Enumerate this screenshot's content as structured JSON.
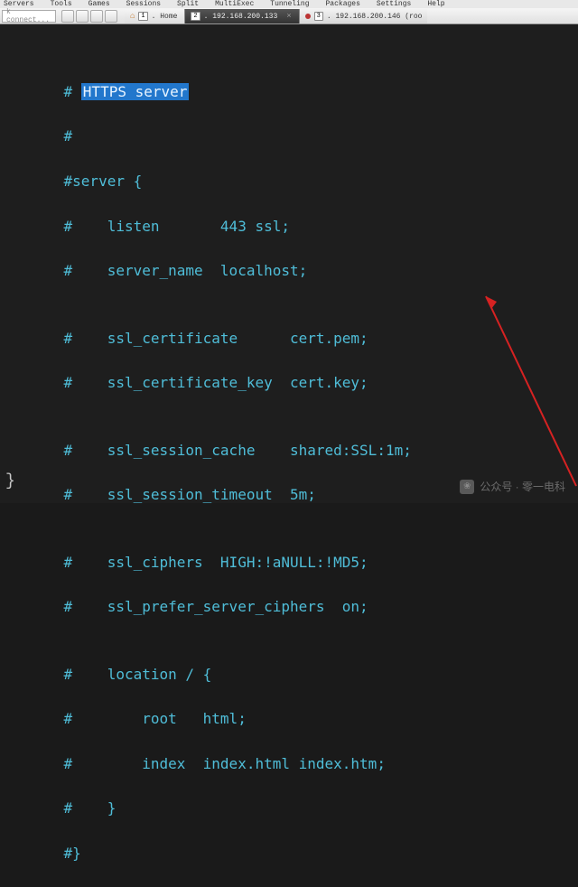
{
  "menubar": [
    "Servers",
    "Tools",
    "Games",
    "Sessions",
    "Split",
    "MultiExec",
    "Tunneling",
    "Packages",
    "Settings",
    "Help"
  ],
  "connect_placeholder": "k connect...",
  "tabs": [
    {
      "num": "1",
      "label": ". Home",
      "active": false,
      "home": true
    },
    {
      "num": "2",
      "label": ". 192.168.200.133",
      "active": true,
      "home": false
    }
  ],
  "tab_extra": {
    "num": "3",
    "label": ". 192.168.200.146 (roo"
  },
  "code": {
    "l1a": "    # ",
    "l1b": "HTTPS server",
    "l2": "    #",
    "l3": "    #server {",
    "l4": "    #    listen       443 ssl;",
    "l5": "    #    server_name  localhost;",
    "l6": "",
    "l7": "    #    ssl_certificate      cert.pem;",
    "l8": "    #    ssl_certificate_key  cert.key;",
    "l9": "",
    "l10": "    #    ssl_session_cache    shared:SSL:1m;",
    "l11": "    #    ssl_session_timeout  5m;",
    "l12": "",
    "l13": "    #    ssl_ciphers  HIGH:!aNULL:!MD5;",
    "l14": "    #    ssl_prefer_server_ciphers  on;",
    "l15": "",
    "l16": "    #    location / {",
    "l17": "    #        root   html;",
    "l18": "    #        index  index.html index.htm;",
    "l19": "    #    }",
    "l20": "    #}"
  },
  "brace": "}",
  "watermark": "公众号 · 零一电科",
  "wx_icon": "❀"
}
